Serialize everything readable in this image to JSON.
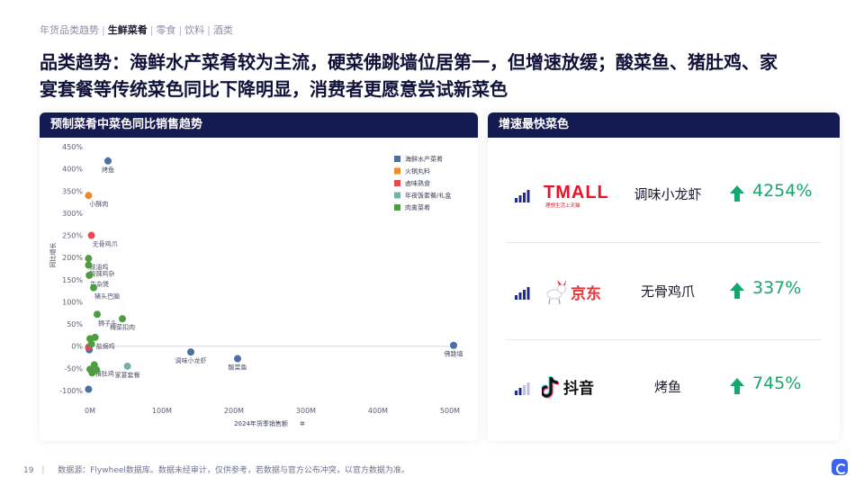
{
  "breadcrumb": {
    "items": [
      "年货品类趋势",
      "生鲜菜肴",
      "零食",
      "饮料",
      "酒类"
    ],
    "active_index": 1
  },
  "headline": {
    "line1": "品类趋势：海鲜水产菜肴较为主流，硬菜佛跳墙位居第一，但增速放缓；酸菜鱼、猪肚鸡、家",
    "line2": "宴套餐等传统菜色同比下降明显，消费者更愿意尝试新菜色"
  },
  "left_panel": {
    "title": "预制菜肴中菜色同比销售趋势"
  },
  "right_panel": {
    "title": "增速最快菜色",
    "items": [
      {
        "brand": "TMALL",
        "brand_sub": "理想生活上天猫",
        "dish": "调味小龙虾",
        "growth": "4254%",
        "signal_level": 4,
        "brand_icon": "tmall-logo"
      },
      {
        "brand": "京东",
        "dish": "无骨鸡爪",
        "growth": "337%",
        "signal_level": 4,
        "brand_icon": "jd-logo"
      },
      {
        "brand": "抖音",
        "dish": "烤鱼",
        "growth": "745%",
        "signal_level": 2,
        "brand_icon": "douyin-logo"
      }
    ]
  },
  "colors": {
    "seafood": "#4a6fa5",
    "hotpot": "#f08a24",
    "braised": "#e14b55",
    "feast": "#75b1a9",
    "meat": "#4d9e3f",
    "header_bg": "#141a52",
    "growth": "#15a86c"
  },
  "chart_data": {
    "type": "scatter",
    "xlabel": "2024年货季销售额",
    "ylabel": "同比增长",
    "xlim": [
      0,
      500000000
    ],
    "ylim": [
      -100,
      450
    ],
    "x_ticks": [
      "0M",
      "100M",
      "200M",
      "300M",
      "400M",
      "500M"
    ],
    "x_tick_values": [
      0,
      100000000,
      200000000,
      300000000,
      400000000,
      500000000
    ],
    "y_ticks": [
      "450%",
      "400%",
      "350%",
      "300%",
      "250%",
      "200%",
      "150%",
      "100%",
      "50%",
      "0%",
      "-50%",
      "-100%"
    ],
    "y_tick_values": [
      450,
      400,
      350,
      300,
      250,
      200,
      150,
      100,
      50,
      0,
      -50,
      -100
    ],
    "legend": [
      {
        "name": "海鲜水产菜肴",
        "color": "#4a6fa5"
      },
      {
        "name": "火锅丸料",
        "color": "#f08a24"
      },
      {
        "name": "卤味熟食",
        "color": "#e14b55"
      },
      {
        "name": "年夜饭套餐/礼盒",
        "color": "#75b1a9"
      },
      {
        "name": "肉禽菜肴",
        "color": "#4d9e3f"
      }
    ],
    "legend_position": "top-right",
    "series": [
      {
        "name": "海鲜水产菜肴",
        "color": "#4a6fa5",
        "points": [
          {
            "x": 25000000,
            "y": 418,
            "label": "烤鱼"
          },
          {
            "x": 140000000,
            "y": -13,
            "label": "调味小龙虾"
          },
          {
            "x": 205000000,
            "y": -28,
            "label": "酸菜鱼"
          },
          {
            "x": 505000000,
            "y": 2,
            "label": "佛跳墙"
          },
          {
            "x": -2000000,
            "y": -97,
            "label": ""
          },
          {
            "x": -1000000,
            "y": -8,
            "label": ""
          }
        ]
      },
      {
        "name": "火锅丸料",
        "color": "#f08a24",
        "points": [
          {
            "x": -2000000,
            "y": 340,
            "label": "小酥肉"
          }
        ]
      },
      {
        "name": "卤味熟食",
        "color": "#e14b55",
        "points": [
          {
            "x": 2000000,
            "y": 250,
            "label": "无骨鸡爪"
          },
          {
            "x": -2000000,
            "y": -2,
            "label": ""
          }
        ]
      },
      {
        "name": "年夜饭套餐/礼盒",
        "color": "#75b1a9",
        "points": [
          {
            "x": 52000000,
            "y": -45,
            "label": "家宴套餐"
          }
        ]
      },
      {
        "name": "肉禽菜肴",
        "color": "#4d9e3f",
        "points": [
          {
            "x": -2000000,
            "y": 198,
            "label": "豉油鸡"
          },
          {
            "x": -2000000,
            "y": 183,
            "label": "酸辣鸡杂"
          },
          {
            "x": -1000000,
            "y": 160,
            "label": "牛杂煲"
          },
          {
            "x": 5000000,
            "y": 132,
            "label": "猪头巴脑"
          },
          {
            "x": 10000000,
            "y": 72,
            "label": "狮子头"
          },
          {
            "x": 45000000,
            "y": 62,
            "label": "梅菜扣肉"
          },
          {
            "x": 7000000,
            "y": 20,
            "label": "盐焗鸡"
          },
          {
            "x": 0,
            "y": 17,
            "label": ""
          },
          {
            "x": 2000000,
            "y": 5,
            "label": ""
          },
          {
            "x": 6000000,
            "y": -42,
            "label": "猪肚鸡"
          },
          {
            "x": 0,
            "y": -52,
            "label": ""
          },
          {
            "x": 3000000,
            "y": -60,
            "label": ""
          },
          {
            "x": 9000000,
            "y": -53,
            "label": ""
          }
        ]
      }
    ]
  },
  "footer": {
    "page": "19",
    "source": "数据源：Flywheel数据库。数据未经审计，仅供参考，若数据与官方公布冲突，以官方数据为准。"
  }
}
